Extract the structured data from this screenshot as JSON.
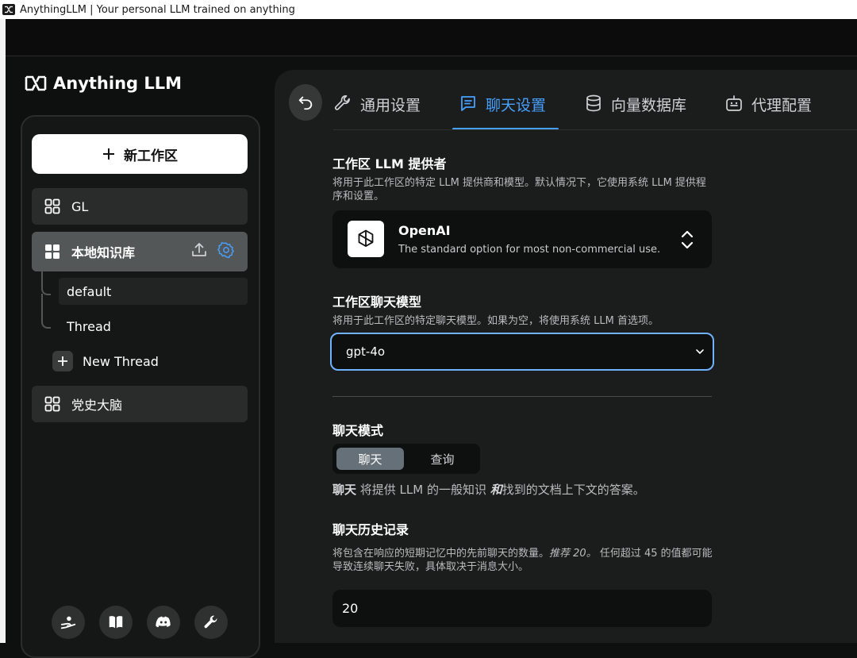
{
  "window": {
    "title": "AnythingLLM | Your personal LLM trained on anything"
  },
  "brand": {
    "name": "Anything LLM"
  },
  "sidebar": {
    "new_workspace_label": "新工作区",
    "workspaces": [
      {
        "label": "GL"
      },
      {
        "label": "本地知识库"
      },
      {
        "label": "党史大脑"
      }
    ],
    "threads": [
      {
        "label": "default",
        "selected": true
      },
      {
        "label": "Thread"
      }
    ],
    "new_thread_label": "New Thread"
  },
  "tabs": [
    {
      "label": "通用设置",
      "icon": "wrench-icon"
    },
    {
      "label": "聊天设置",
      "icon": "chat-icon",
      "active": true
    },
    {
      "label": "向量数据库",
      "icon": "database-icon"
    },
    {
      "label": "代理配置",
      "icon": "robot-icon"
    }
  ],
  "llm_provider": {
    "title": "工作区 LLM 提供者",
    "description": "将用于此工作区的特定 LLM 提供商和模型。默认情况下，它使用系统 LLM 提供程序和设置。",
    "selected_name": "OpenAI",
    "selected_description": "The standard option for most non-commercial use."
  },
  "chat_model": {
    "title": "工作区聊天模型",
    "description": "将用于此工作区的特定聊天模型。如果为空，将使用系统 LLM 首选项。",
    "value": "gpt-4o"
  },
  "chat_mode": {
    "title": "聊天模式",
    "options": [
      "聊天",
      "查询"
    ],
    "selected": "聊天",
    "desc_bold": "聊天",
    "desc_mid": " 将提供 LLM 的一般知识 ",
    "desc_em": "和",
    "desc_end": "找到的文档上下文的答案。"
  },
  "chat_history": {
    "title": "聊天历史记录",
    "description_pre": "将包含在响应的短期记忆中的先前聊天的数量。",
    "description_em": "推荐 20。",
    "description_post": " 任何超过 45 的值都可能导致连续聊天失败，具体取决于消息大小。",
    "value": "20"
  },
  "colors": {
    "accent": "#46a0ff",
    "focus_border": "#6fb2ff"
  }
}
